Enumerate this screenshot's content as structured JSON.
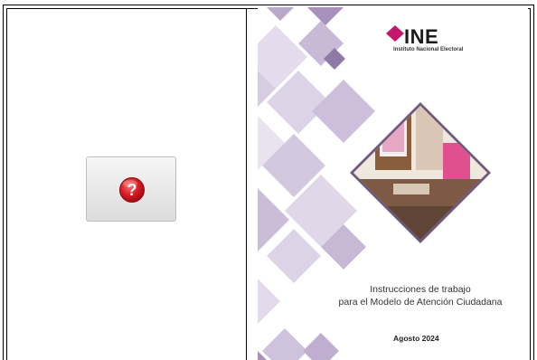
{
  "help_button": {
    "icon": "question-mark-icon",
    "glyph": "?",
    "icon_color": "#d81e24"
  },
  "cover": {
    "logo_text": "INE",
    "logo_subtitle": "Instituto Nacional Electoral",
    "title_line1": "Instrucciones de trabajo",
    "title_line2": "para el Modelo de Atención Ciudadana",
    "date": "Agosto 2024",
    "colors": {
      "diamond_light": "#e7e1ec",
      "diamond_mid": "#c9bcd6",
      "diamond_dark": "#8f7aa5",
      "brand_pink": "#c4176b"
    }
  }
}
